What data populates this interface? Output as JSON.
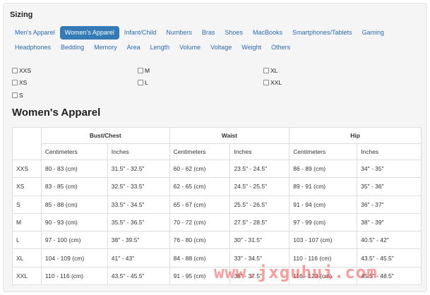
{
  "sizing": {
    "heading": "Sizing",
    "tabs": [
      {
        "label": "Men's Apparel",
        "active": false
      },
      {
        "label": "Women's Apparel",
        "active": true
      },
      {
        "label": "Infant/Child",
        "active": false
      },
      {
        "label": "Numbers",
        "active": false
      },
      {
        "label": "Bras",
        "active": false
      },
      {
        "label": "Shoes",
        "active": false
      },
      {
        "label": "MacBooks",
        "active": false
      },
      {
        "label": "Smartphones/Tablets",
        "active": false
      },
      {
        "label": "Gaming",
        "active": false
      },
      {
        "label": "Headphones",
        "active": false
      },
      {
        "label": "Bedding",
        "active": false
      },
      {
        "label": "Memory",
        "active": false
      },
      {
        "label": "Area",
        "active": false
      },
      {
        "label": "Length",
        "active": false
      },
      {
        "label": "Volume",
        "active": false
      },
      {
        "label": "Voltage",
        "active": false
      },
      {
        "label": "Weight",
        "active": false
      },
      {
        "label": "Others",
        "active": false
      }
    ],
    "size_filters": [
      "XXS",
      "M",
      "XL",
      "XS",
      "L",
      "XXL",
      "S"
    ]
  },
  "table": {
    "title": "Women's Apparel",
    "groups": [
      "Bust/Chest",
      "Waist",
      "Hip"
    ],
    "units": [
      "Centimeters",
      "Inches",
      "Centimeters",
      "Inches",
      "Centimeters",
      "Inches"
    ],
    "rows": [
      [
        "XXS",
        "80 - 83 (cm)",
        "31.5\" - 32.5\"",
        "60 - 62 (cm)",
        "23.5\" - 24.5\"",
        "86 - 89 (cm)",
        "34\" - 35\""
      ],
      [
        "XS",
        "83 - 85 (cm)",
        "32.5\" - 33.5\"",
        "62 - 65 (cm)",
        "24.5\" - 25.5\"",
        "89 - 91 (cm)",
        "35\" - 36\""
      ],
      [
        "S",
        "85 - 88 (cm)",
        "33.5\" - 34.5\"",
        "65 - 67 (cm)",
        "25.5\" - 26.5\"",
        "91 - 94 (cm)",
        "36\" - 37\""
      ],
      [
        "M",
        "90 - 93 (cm)",
        "35.5\" - 36.5\"",
        "70 - 72 (cm)",
        "27.5\" - 28.5\"",
        "97 - 99 (cm)",
        "38\" - 39\""
      ],
      [
        "L",
        "97 - 100 (cm)",
        "38\" - 39.5\"",
        "76 - 80 (cm)",
        "30\" - 31.5\"",
        "103 - 107 (cm)",
        "40.5\" - 42\""
      ],
      [
        "XL",
        "104 - 109 (cm)",
        "41\" - 43\"",
        "84 - 88 (cm)",
        "33\" - 34.5\"",
        "110 - 116 (cm)",
        "43.5\" - 45.5\""
      ],
      [
        "XXL",
        "110 - 116 (cm)",
        "43.5\" - 45.5\"",
        "91 - 95 (cm)",
        "36\" - 37.5\"",
        "116 - 123 (cm)",
        "45.5\" - 48.5\""
      ]
    ]
  },
  "watermark": "www.jxguhui.com",
  "colors": {
    "link": "#2a6ab8",
    "active_pill": "#337ab7",
    "panel_bg": "#f5f5f5",
    "border": "#dddddd",
    "watermark": "#f44a4a"
  }
}
